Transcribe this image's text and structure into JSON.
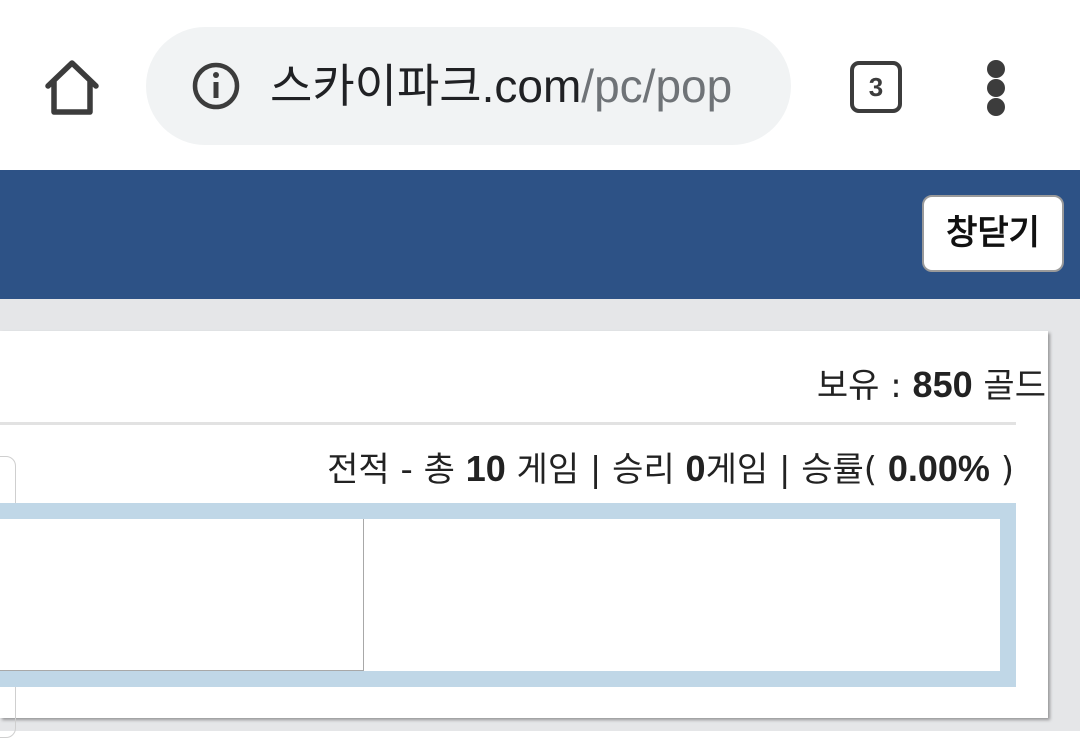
{
  "browser": {
    "url_domain": "스카이파크.com",
    "url_path": "/pc/pop",
    "tab_count": "3",
    "icons": {
      "home": "home-icon",
      "info": "info-icon",
      "menu": "more-vert-icon"
    }
  },
  "popup": {
    "close_label": "창닫기",
    "header_color": "#2d5286"
  },
  "stats": {
    "gold_prefix": "보유 : ",
    "gold_value": "850",
    "gold_suffix": " 골드",
    "record_prefix": "전적 - 총 ",
    "total_games": "10",
    "games_word": " 게임 | 승리 ",
    "wins": "0",
    "wins_suffix": "게임 | 승률( ",
    "win_rate": "0.00%",
    "rate_close": " )"
  }
}
